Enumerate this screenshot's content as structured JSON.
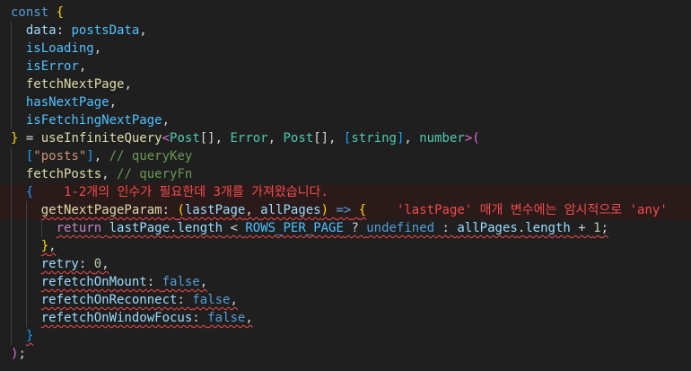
{
  "code": {
    "lines": [
      {
        "tokens": [
          {
            "t": "const",
            "c": "kw"
          },
          {
            "t": " "
          },
          {
            "t": "{",
            "c": "b1"
          }
        ]
      },
      {
        "tokens": [
          {
            "t": "  "
          },
          {
            "t": "data",
            "c": "var"
          },
          {
            "t": ": "
          },
          {
            "t": "postsData",
            "c": "cst"
          },
          {
            "t": ","
          }
        ]
      },
      {
        "tokens": [
          {
            "t": "  "
          },
          {
            "t": "isLoading",
            "c": "cst"
          },
          {
            "t": ","
          }
        ]
      },
      {
        "tokens": [
          {
            "t": "  "
          },
          {
            "t": "isError",
            "c": "cst"
          },
          {
            "t": ","
          }
        ]
      },
      {
        "tokens": [
          {
            "t": "  "
          },
          {
            "t": "fetchNextPage",
            "c": "fn"
          },
          {
            "t": ","
          }
        ]
      },
      {
        "tokens": [
          {
            "t": "  "
          },
          {
            "t": "hasNextPage",
            "c": "cst"
          },
          {
            "t": ","
          }
        ]
      },
      {
        "tokens": [
          {
            "t": "  "
          },
          {
            "t": "isFetchingNextPage",
            "c": "cst"
          },
          {
            "t": ","
          }
        ]
      },
      {
        "tokens": [
          {
            "t": "}",
            "c": "b1"
          },
          {
            "t": " = "
          },
          {
            "t": "useInfiniteQuery",
            "c": "fn"
          },
          {
            "t": "<",
            "c": "b2"
          },
          {
            "t": "Post",
            "c": "typ"
          },
          {
            "t": "[], "
          },
          {
            "t": "Error",
            "c": "typ"
          },
          {
            "t": ", "
          },
          {
            "t": "Post",
            "c": "typ"
          },
          {
            "t": "[], "
          },
          {
            "t": "[",
            "c": "b3"
          },
          {
            "t": "string",
            "c": "typ"
          },
          {
            "t": "]",
            "c": "b3"
          },
          {
            "t": ", "
          },
          {
            "t": "number",
            "c": "typ"
          },
          {
            "t": ">",
            "c": "b2"
          },
          {
            "t": "(",
            "c": "b2"
          }
        ]
      },
      {
        "tokens": [
          {
            "t": "  "
          },
          {
            "t": "[",
            "c": "b3"
          },
          {
            "t": "\"posts\"",
            "c": "str"
          },
          {
            "t": "]",
            "c": "b3"
          },
          {
            "t": ", "
          },
          {
            "t": "// queryKey",
            "c": "cmt"
          }
        ]
      },
      {
        "tokens": [
          {
            "t": "  "
          },
          {
            "t": "fetchPosts",
            "c": "fn"
          },
          {
            "t": ", "
          },
          {
            "t": "// queryFn",
            "c": "cmt"
          }
        ]
      },
      {
        "error": true,
        "tokens": [
          {
            "t": "  "
          },
          {
            "t": "{",
            "c": "b3"
          },
          {
            "t": "    "
          },
          {
            "t": "1-2개의 인수가 필요한데 3개를 가져왔습니다.",
            "c": "diag"
          }
        ]
      },
      {
        "error": true,
        "tokens": [
          {
            "t": "    "
          },
          {
            "t": "getNextPageParam",
            "c": "fn",
            "sq": true
          },
          {
            "t": ": ",
            "sq": true
          },
          {
            "t": "(",
            "c": "b1",
            "sq": true
          },
          {
            "t": "lastPage",
            "c": "var",
            "sq": true
          },
          {
            "t": ", ",
            "sq": true
          },
          {
            "t": "allPages",
            "c": "var",
            "sq": true
          },
          {
            "t": ")",
            "c": "b1",
            "sq": true
          },
          {
            "t": " ",
            "sq": true
          },
          {
            "t": "=>",
            "c": "kw",
            "sq": true
          },
          {
            "t": " ",
            "sq": true
          },
          {
            "t": "{",
            "c": "b1",
            "sq": true
          },
          {
            "t": "    "
          },
          {
            "t": "'lastPage' 매개 변수에는 암시적으로 'any'",
            "c": "diag"
          }
        ]
      },
      {
        "tokens": [
          {
            "t": "      "
          },
          {
            "t": "return",
            "c": "ctl",
            "sq": true
          },
          {
            "t": " ",
            "sq": true
          },
          {
            "t": "lastPage",
            "c": "var",
            "sq": true
          },
          {
            "t": ".",
            "sq": true
          },
          {
            "t": "length",
            "c": "var",
            "sq": true
          },
          {
            "t": " < ",
            "sq": true
          },
          {
            "t": "ROWS_PER_PAGE",
            "c": "cst",
            "sq": true
          },
          {
            "t": " ? ",
            "sq": true
          },
          {
            "t": "undefined",
            "c": "kw",
            "sq": true
          },
          {
            "t": " : ",
            "sq": true
          },
          {
            "t": "allPages",
            "c": "var",
            "sq": true
          },
          {
            "t": ".",
            "sq": true
          },
          {
            "t": "length",
            "c": "var",
            "sq": true
          },
          {
            "t": " + ",
            "sq": true
          },
          {
            "t": "1",
            "c": "num",
            "sq": true
          },
          {
            "t": ";",
            "sq": true
          }
        ]
      },
      {
        "tokens": [
          {
            "t": "    "
          },
          {
            "t": "}",
            "c": "b1",
            "sq": true
          },
          {
            "t": ",",
            "sq": true
          }
        ]
      },
      {
        "tokens": [
          {
            "t": "    "
          },
          {
            "t": "retry",
            "c": "var",
            "sq": true
          },
          {
            "t": ": ",
            "sq": true
          },
          {
            "t": "0",
            "c": "num",
            "sq": true
          },
          {
            "t": ",",
            "sq": true
          }
        ]
      },
      {
        "tokens": [
          {
            "t": "    "
          },
          {
            "t": "refetchOnMount",
            "c": "var",
            "sq": true
          },
          {
            "t": ": ",
            "sq": true
          },
          {
            "t": "false",
            "c": "kw",
            "sq": true
          },
          {
            "t": ",",
            "sq": true
          }
        ]
      },
      {
        "tokens": [
          {
            "t": "    "
          },
          {
            "t": "refetchOnReconnect",
            "c": "var",
            "sq": true
          },
          {
            "t": ": ",
            "sq": true
          },
          {
            "t": "false",
            "c": "kw",
            "sq": true
          },
          {
            "t": ",",
            "sq": true
          }
        ]
      },
      {
        "tokens": [
          {
            "t": "    "
          },
          {
            "t": "refetchOnWindowFocus",
            "c": "var",
            "sq": true
          },
          {
            "t": ": ",
            "sq": true
          },
          {
            "t": "false",
            "c": "kw",
            "sq": true
          },
          {
            "t": ",",
            "sq": true
          }
        ]
      },
      {
        "tokens": [
          {
            "t": "  "
          },
          {
            "t": "}",
            "c": "b3",
            "sq": true
          }
        ]
      },
      {
        "tokens": [
          {
            "t": ")",
            "c": "b2"
          },
          {
            "t": ";"
          }
        ]
      }
    ]
  }
}
